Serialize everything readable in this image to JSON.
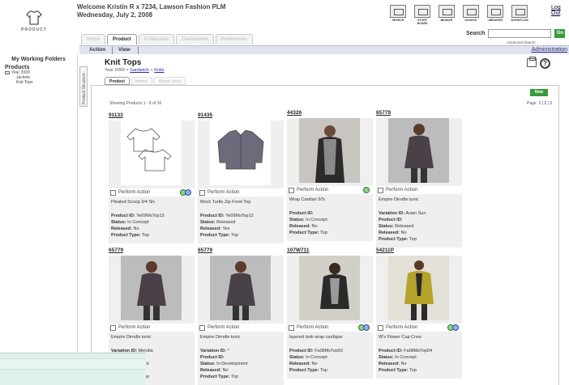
{
  "header": {
    "welcome_line1": "Welcome Kristin R x 7234, Lawson Fashion PLM",
    "welcome_line2": "Wednesday, July 2, 2008",
    "logo_label": "PRODUCT",
    "logout": "Log Out",
    "top_icons": [
      "SEARCH",
      "STORY BOARD",
      "BEAKER",
      "SOURCE",
      "LIBRARIES",
      "WORKFLOW"
    ],
    "search_label": "Search",
    "search_value": "",
    "go_label": "Go",
    "advanced_search": "Advanced Search"
  },
  "main_tabs": [
    "Home",
    "Product",
    "Collaborate",
    "Dashboards",
    "Preferences"
  ],
  "active_main_tab": "Product",
  "subbar": {
    "action": "Action",
    "view": "View",
    "admin": "Administration"
  },
  "sidebar": {
    "title": "My Working Folders",
    "section": "Products",
    "tree_root": "Year 2009",
    "tree_items": [
      "Jackets",
      "Knit Tops"
    ],
    "structure_label": "Product Structure"
  },
  "page": {
    "title": "Knit Tops",
    "crumb_prefix": "Year 2009 > ",
    "crumb_link1": "Sandwich",
    "crumb_sep": " > ",
    "crumb_link2": "Knits"
  },
  "inner_tabs": [
    "Product",
    "History",
    "Where Used"
  ],
  "toolbar": {
    "new_label": "New"
  },
  "list": {
    "showing": "Showing Products  1 - 8  of  16",
    "page_label": "Page",
    "pages": "1 | 2 | 3"
  },
  "products": [
    {
      "id": "91133",
      "action": "Perform Action",
      "name": "Pleated Scoop 3/4 Slv",
      "details": [
        [
          "Product ID:",
          "Ye09MsTop13"
        ],
        [
          "Status:",
          "In Concept"
        ],
        [
          "Released:",
          "No"
        ],
        [
          "Product Type:",
          "Top"
        ]
      ]
    },
    {
      "id": "91435",
      "action": "Perform Action",
      "name": "Mock Turtle Zip Front Top",
      "details": [
        [
          "Product ID:",
          "Ye09MsTop12"
        ],
        [
          "Status:",
          "Released"
        ],
        [
          "Released:",
          "Yes"
        ],
        [
          "Product Type:",
          "Top"
        ]
      ]
    },
    {
      "id": "44326",
      "action": "Perform Action",
      "name": "Wrap Cardian 5/S",
      "details": [
        [
          "Product ID:",
          ""
        ],
        [
          "Status:",
          "In Concept"
        ],
        [
          "Released:",
          "No"
        ],
        [
          "Product Type:",
          "Top"
        ]
      ]
    },
    {
      "id": "65779",
      "action": "Perform Action",
      "name": "Empire Dirndle tunic",
      "details": [
        [
          "Variation ID:",
          "Asian Sun"
        ],
        [
          "Product ID:",
          ""
        ],
        [
          "Status:",
          "Released"
        ],
        [
          "Released:",
          "No"
        ],
        [
          "Product Type:",
          "Top"
        ]
      ]
    },
    {
      "id": "65779",
      "action": "Perform Action",
      "name": "Empire Dirndle tunic",
      "details": [
        [
          "Variation ID:",
          "Mendia"
        ],
        [
          "Product ID:",
          ""
        ],
        [
          "Status:",
          "In Concept"
        ],
        [
          "Released:",
          ""
        ],
        [
          "Product Type:",
          "Top"
        ]
      ]
    },
    {
      "id": "65779",
      "action": "Perform Action",
      "name": "Empire Dirndle tunic",
      "details": [
        [
          "Variation ID:",
          "*"
        ],
        [
          "Product ID:",
          ""
        ],
        [
          "Status:",
          "In Development"
        ],
        [
          "Released:",
          "No"
        ],
        [
          "Product Type:",
          "Top"
        ]
      ]
    },
    {
      "id": "107W711",
      "action": "Perform Action",
      "name": "layered look wrap cardigan",
      "details": [
        [
          "Product ID:",
          "Fa08MsTop03"
        ],
        [
          "Status:",
          "In Concept"
        ],
        [
          "Released:",
          "No"
        ],
        [
          "Product Type:",
          "Top"
        ]
      ]
    },
    {
      "id": "54211P",
      "action": "Perform Action",
      "name": "W's Flower Cap Crew",
      "details": [
        [
          "Product ID:",
          "Fa08MsTop04"
        ],
        [
          "Status:",
          "In Concept"
        ],
        [
          "Released:",
          "No"
        ],
        [
          "Product Type:",
          "Top"
        ]
      ]
    }
  ],
  "colors": {
    "accent_green": "#3a9a3a",
    "link_blue": "#2a2ab0",
    "subbar_bg": "#dfe3f0"
  }
}
